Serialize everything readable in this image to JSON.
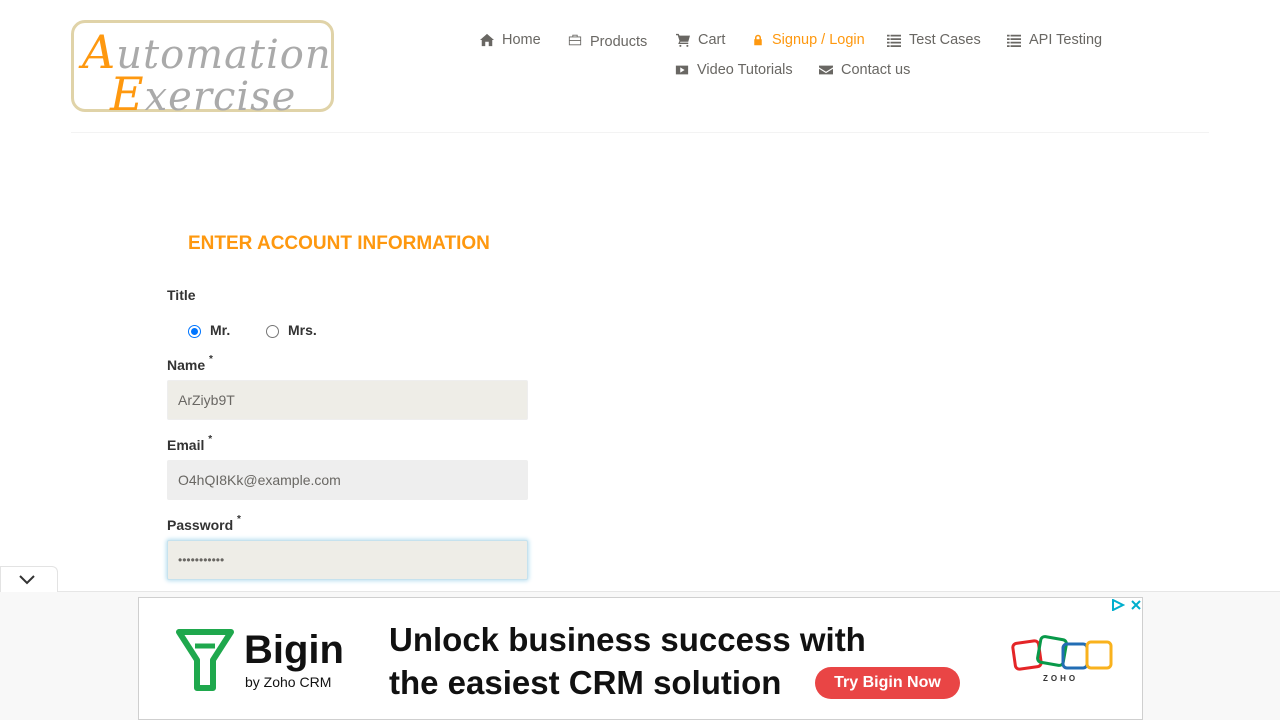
{
  "logo": {
    "line1_cap": "A",
    "line1_rest": "utomation",
    "line2_cap": "E",
    "line2_rest": "xercise"
  },
  "nav": {
    "items": [
      {
        "label": "Home",
        "icon": "home-icon"
      },
      {
        "label": "Products",
        "icon": "briefcase-icon"
      },
      {
        "label": "Cart",
        "icon": "cart-icon"
      },
      {
        "label": "Signup / Login",
        "icon": "lock-icon",
        "active": true
      },
      {
        "label": "Test Cases",
        "icon": "list-icon"
      },
      {
        "label": "API Testing",
        "icon": "list-icon"
      },
      {
        "label": "Video Tutorials",
        "icon": "youtube-play-icon"
      },
      {
        "label": "Contact us",
        "icon": "envelope-icon"
      }
    ]
  },
  "form": {
    "title": "Enter Account Information",
    "title_label": "Title",
    "options": [
      {
        "label": "Mr.",
        "checked": true
      },
      {
        "label": "Mrs.",
        "checked": false
      }
    ],
    "name_label": "Name",
    "name_value": "ArZiyb9T",
    "email_label": "Email",
    "email_value": "O4hQI8Kk@example.com",
    "password_label": "Password",
    "password_value": "•••••••••••",
    "required_mark": "*"
  },
  "ad": {
    "brand": "Bigin",
    "by": "by Zoho CRM",
    "headline": "Unlock business success with the easiest CRM solution",
    "cta": "Try Bigin Now",
    "zoho": "ZOHO"
  },
  "colors": {
    "accent": "#fe980f",
    "radio": "#0075ff",
    "cta": "#e94545"
  }
}
